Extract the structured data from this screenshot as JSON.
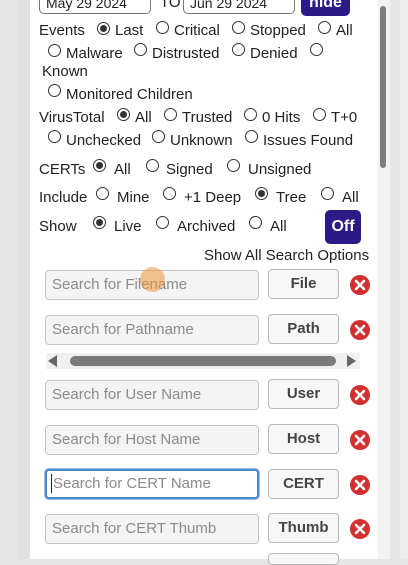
{
  "dates": {
    "from": "May 29 2024",
    "to_label": "TO",
    "to": "Jun 29 2024",
    "hide_label": "hide"
  },
  "events": {
    "label": "Events",
    "options": [
      "Last",
      "Critical",
      "Stopped",
      "All",
      "Malware",
      "Distrusted",
      "Denied",
      "Known",
      "Monitored Children"
    ],
    "selected": "Last"
  },
  "virustotal": {
    "label": "VirusTotal",
    "options": [
      "All",
      "Trusted",
      "0 Hits",
      "T+0",
      "Unchecked",
      "Unknown",
      "Issues Found"
    ],
    "selected": "All"
  },
  "certs": {
    "label": "CERTs",
    "options": [
      "All",
      "Signed",
      "Unsigned"
    ],
    "selected": "All"
  },
  "include": {
    "label": "Include",
    "options": [
      "Mine",
      "+1 Deep",
      "Tree",
      "All"
    ],
    "selected": "Tree"
  },
  "show": {
    "label": "Show",
    "options": [
      "Live",
      "Archived",
      "All"
    ],
    "selected": "Live",
    "toggle_label": "Off"
  },
  "show_all_label": "Show All Search Options",
  "searches": [
    {
      "placeholder": "Search for Filename",
      "button": "File"
    },
    {
      "placeholder": "Search for Pathname",
      "button": "Path"
    },
    {
      "placeholder": "Search for User Name",
      "button": "User"
    },
    {
      "placeholder": "Search for Host Name",
      "button": "Host"
    },
    {
      "placeholder": "Search for CERT Name",
      "button": "CERT"
    },
    {
      "placeholder": "Search for CERT Thumb",
      "button": "Thumb"
    }
  ],
  "colors": {
    "accent": "#2b1a86",
    "remove": "#d32f2f",
    "focus": "#4a86c6"
  }
}
